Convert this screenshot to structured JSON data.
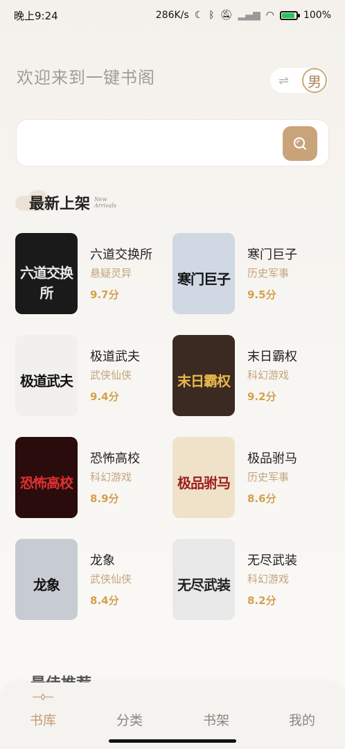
{
  "status_bar": {
    "time": "晚上9:24",
    "network_speed": "286K/s",
    "battery_percent": "100%"
  },
  "header": {
    "welcome": "欢迎来到一键书阁",
    "swap_icon": "⇌",
    "gender": "男"
  },
  "search": {
    "placeholder": "",
    "button_icon": "search-icon"
  },
  "section": {
    "title": "最新上架",
    "subtitle_line1": "New",
    "subtitle_line2": "Arrivals"
  },
  "books": [
    {
      "title": "六道交换所",
      "genre": "悬疑灵异",
      "score": "9.7分",
      "cover_bg": "#1a1a1a",
      "cover_fg": "#e8e8e8"
    },
    {
      "title": "寒门巨子",
      "genre": "历史军事",
      "score": "9.5分",
      "cover_bg": "#cfd8e3",
      "cover_fg": "#111111"
    },
    {
      "title": "极道武夫",
      "genre": "武侠仙侠",
      "score": "9.4分",
      "cover_bg": "#f1f0ee",
      "cover_fg": "#111111"
    },
    {
      "title": "末日霸权",
      "genre": "科幻游戏",
      "score": "9.2分",
      "cover_bg": "#3a2a22",
      "cover_fg": "#e8b84a"
    },
    {
      "title": "恐怖高校",
      "genre": "科幻游戏",
      "score": "8.9分",
      "cover_bg": "#2a0c0c",
      "cover_fg": "#e03030"
    },
    {
      "title": "极品驸马",
      "genre": "历史军事",
      "score": "8.6分",
      "cover_bg": "#efe2c9",
      "cover_fg": "#9b1c1c"
    },
    {
      "title": "龙象",
      "genre": "武侠仙侠",
      "score": "8.4分",
      "cover_bg": "#c6ccd2",
      "cover_fg": "#111111"
    },
    {
      "title": "无尽武装",
      "genre": "科幻游戏",
      "score": "8.2分",
      "cover_bg": "#e9e9e9",
      "cover_fg": "#222222"
    }
  ],
  "partial_heading": "最佳推荐",
  "nav": {
    "items": [
      "书库",
      "分类",
      "书架",
      "我的"
    ],
    "active_index": 0,
    "active_color": "#c49b70"
  },
  "colors": {
    "accent": "#c9a37a",
    "genre": "#c4a47e",
    "score": "#d4a04f"
  }
}
